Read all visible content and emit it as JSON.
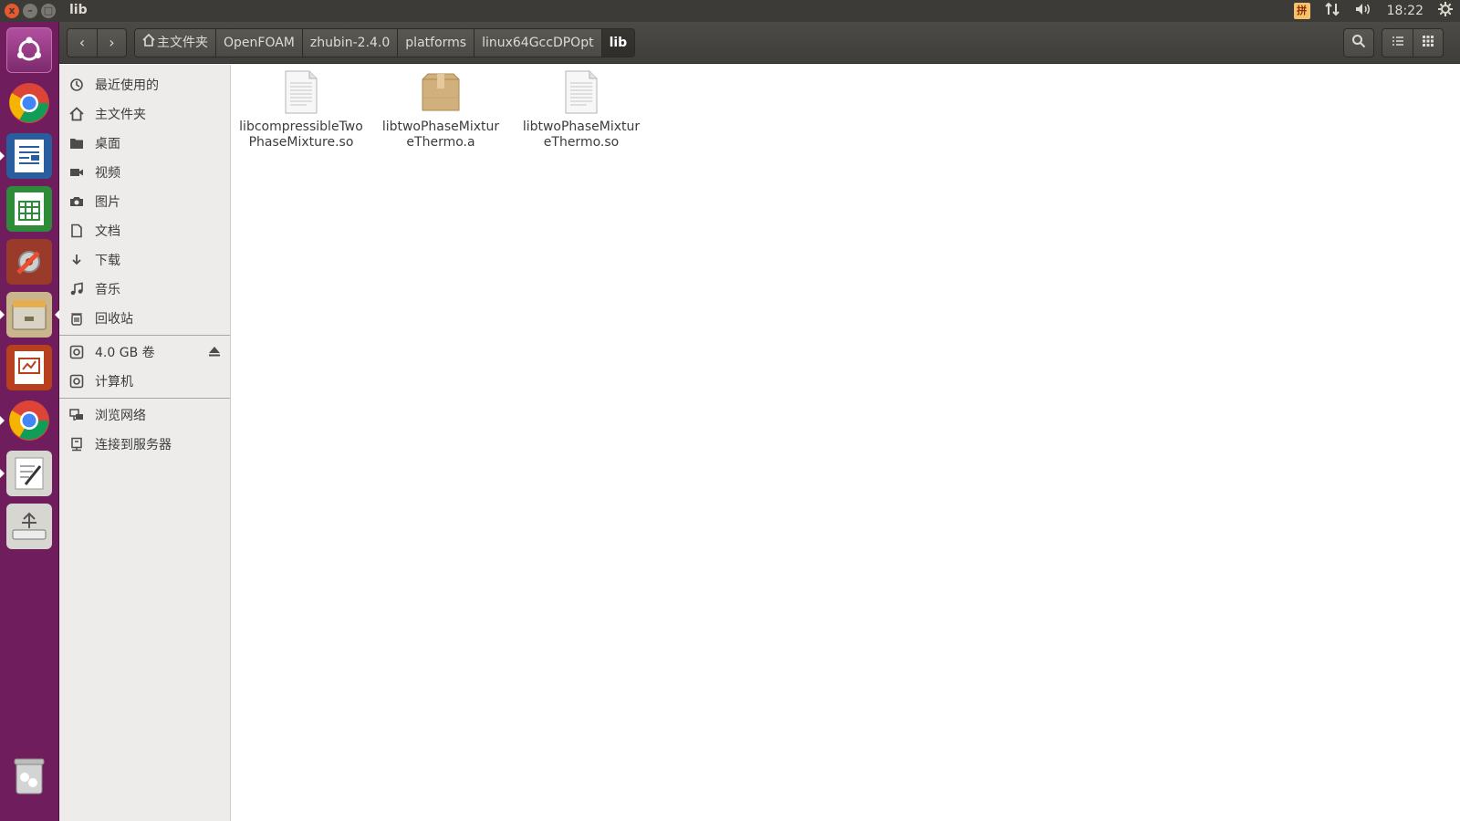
{
  "window": {
    "title": "lib",
    "close_label": "x",
    "minimize_label": "–",
    "maximize_label": "□"
  },
  "panel": {
    "time": "18:22"
  },
  "toolbar": {
    "back_label": "‹",
    "forward_label": "›",
    "breadcrumbs": [
      {
        "label": "主文件夹",
        "icon": "home-icon"
      },
      {
        "label": "OpenFOAM"
      },
      {
        "label": "zhubin-2.4.0"
      },
      {
        "label": "platforms"
      },
      {
        "label": "linux64GccDPOpt"
      },
      {
        "label": "lib",
        "active": true
      }
    ]
  },
  "sidebar": {
    "places": [
      {
        "label": "最近使用的",
        "icon": "recent-icon"
      },
      {
        "label": "主文件夹",
        "icon": "home-icon"
      },
      {
        "label": "桌面",
        "icon": "desktop-folder-icon"
      },
      {
        "label": "视频",
        "icon": "video-icon"
      },
      {
        "label": "图片",
        "icon": "camera-icon"
      },
      {
        "label": "文档",
        "icon": "document-icon"
      },
      {
        "label": "下载",
        "icon": "download-icon"
      },
      {
        "label": "音乐",
        "icon": "music-icon"
      },
      {
        "label": "回收站",
        "icon": "trash-icon"
      }
    ],
    "devices": [
      {
        "label": "4.0 GB 卷",
        "icon": "drive-icon",
        "ejectable": true
      },
      {
        "label": "计算机",
        "icon": "drive-icon"
      }
    ],
    "network": [
      {
        "label": "浏览网络",
        "icon": "network-icon"
      },
      {
        "label": "连接到服务器",
        "icon": "server-icon"
      }
    ]
  },
  "files": [
    {
      "line1": "libcompressibleTwo",
      "line2": "PhaseMixture.so",
      "type": "document"
    },
    {
      "line1": "libtwoPhaseMixtur",
      "line2": "eThermo.a",
      "type": "archive"
    },
    {
      "line1": "libtwoPhaseMixtur",
      "line2": "eThermo.so",
      "type": "document"
    }
  ],
  "colors": {
    "launcher_bg": "#6f1d5c",
    "panel_bg": "#3c3b37",
    "close_button": "#e7582e",
    "sidebar_bg": "#edeceb"
  }
}
